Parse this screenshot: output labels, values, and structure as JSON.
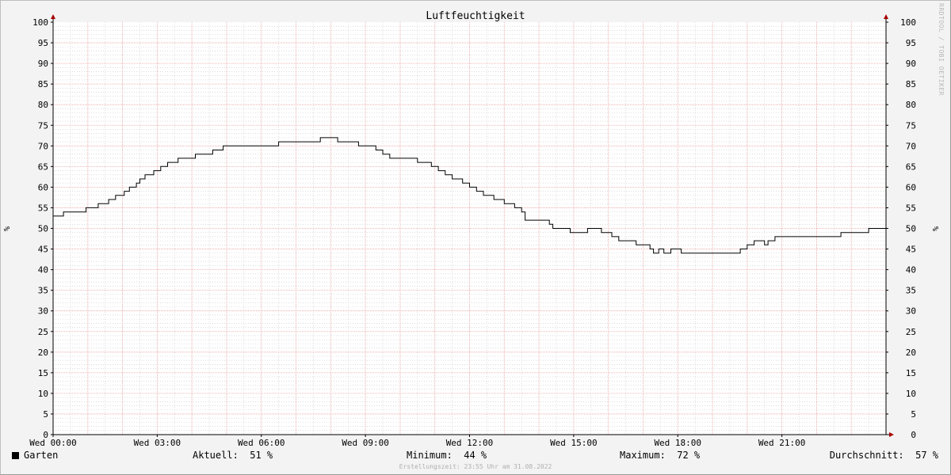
{
  "chart_data": {
    "type": "line",
    "title": "Luftfeuchtigkeit",
    "ylabel": "%",
    "ylim": [
      0,
      100
    ],
    "yticks": [
      0,
      5,
      10,
      15,
      20,
      25,
      30,
      35,
      40,
      45,
      50,
      55,
      60,
      65,
      70,
      75,
      80,
      85,
      90,
      95,
      100
    ],
    "xlim_hours": [
      0,
      24
    ],
    "xticks": [
      {
        "hour": 0,
        "label": "Wed 00:00"
      },
      {
        "hour": 3,
        "label": "Wed 03:00"
      },
      {
        "hour": 6,
        "label": "Wed 06:00"
      },
      {
        "hour": 9,
        "label": "Wed 09:00"
      },
      {
        "hour": 12,
        "label": "Wed 12:00"
      },
      {
        "hour": 15,
        "label": "Wed 15:00"
      },
      {
        "hour": 18,
        "label": "Wed 18:00"
      },
      {
        "hour": 21,
        "label": "Wed 21:00"
      }
    ],
    "grid": true,
    "legend": "bottom-left",
    "series": [
      {
        "name": "Garten",
        "color": "#000000",
        "x_hours": [
          0,
          0.3,
          0.9,
          0.95,
          1.1,
          1.3,
          1.45,
          1.6,
          1.8,
          1.9,
          2.05,
          2.2,
          2.4,
          2.5,
          2.65,
          2.9,
          3.1,
          3.3,
          3.6,
          4.1,
          4.6,
          4.9,
          5.8,
          6.5,
          7.7,
          8.2,
          8.8,
          9.3,
          9.5,
          9.7,
          9.9,
          10.5,
          10.9,
          11.1,
          11.3,
          11.5,
          11.8,
          12.0,
          12.2,
          12.4,
          12.7,
          13.0,
          13.3,
          13.5,
          13.6,
          14.3,
          14.4,
          14.5,
          14.9,
          15.3,
          15.4,
          15.6,
          15.8,
          16.1,
          16.3,
          16.8,
          17.2,
          17.3,
          17.45,
          17.6,
          17.8,
          18.1,
          18.5,
          19.0,
          19.5,
          19.8,
          19.9,
          20.0,
          20.2,
          20.5,
          20.6,
          20.8,
          21.2,
          22.1,
          22.7,
          23.0,
          23.5,
          24.0
        ],
        "values": [
          53,
          54,
          54,
          55,
          55,
          56,
          56,
          57,
          58,
          58,
          59,
          60,
          61,
          62,
          63,
          64,
          65,
          66,
          67,
          68,
          69,
          70,
          70,
          71,
          72,
          71,
          70,
          69,
          68,
          67,
          67,
          66,
          65,
          64,
          63,
          62,
          61,
          60,
          59,
          58,
          57,
          56,
          55,
          54,
          52,
          51,
          50,
          50,
          49,
          49,
          50,
          50,
          49,
          48,
          47,
          46,
          45,
          44,
          45,
          44,
          45,
          44,
          44,
          44,
          44,
          45,
          45,
          46,
          47,
          46,
          47,
          48,
          48,
          48,
          49,
          49,
          50,
          51
        ]
      }
    ],
    "summary": {
      "current_label": "Aktuell:",
      "current_value": "51 %",
      "min_label": "Minimum:",
      "min_value": "44 %",
      "max_label": "Maximum:",
      "max_value": "72 %",
      "avg_label": "Durchschnitt:",
      "avg_value": "57 %"
    }
  },
  "footer_text": "Erstellungszeit: 23:55 Uhr am 31.08.2022",
  "watermark_text": "RRDTOOL / TOBI OETIKER",
  "colors": {
    "background": "#f3f3f3",
    "plot_background": "#ffffff",
    "major_grid": "#e8a0a0",
    "minor_grid": "#c8c8c8",
    "axis": "#000000",
    "arrow": "#aa0000"
  }
}
